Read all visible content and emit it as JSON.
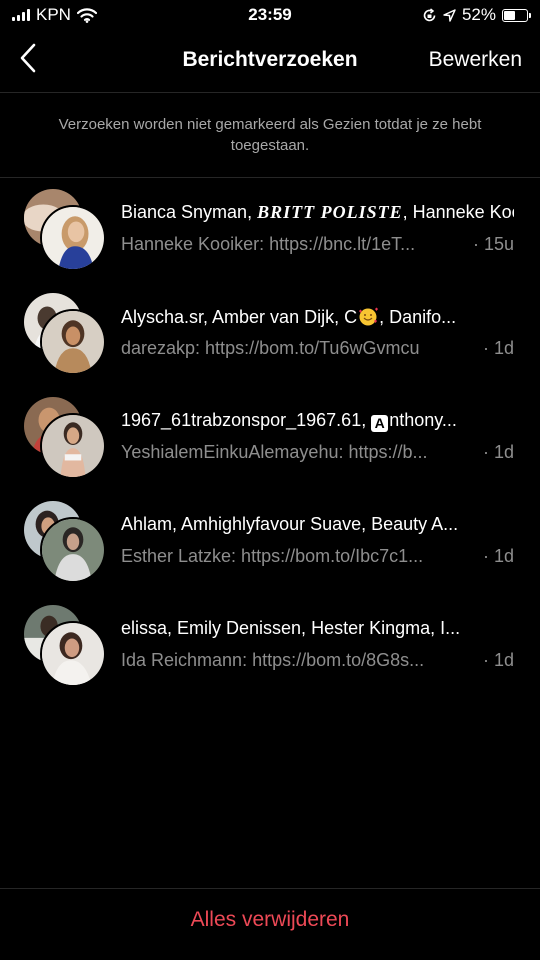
{
  "status_bar": {
    "carrier": "KPN",
    "time": "23:59",
    "battery_percent": "52%",
    "battery_level": 0.52
  },
  "header": {
    "title": "Berichtverzoeken",
    "edit_label": "Bewerken",
    "back_icon": "chevron-left-icon"
  },
  "notice": "Verzoeken worden niet gemarkeerd als Gezien totdat je ze hebt toegestaan.",
  "requests": [
    {
      "title_prefix": "Bianca Snyman, ",
      "title_special": "BRITT POLISTE",
      "title_suffix": ", Hanneke Kooiker",
      "preview": "Hanneke Kooiker: https://bnc.lt/1eT...",
      "time": "· 15u"
    },
    {
      "title_prefix": "Alyscha.sr, Amber van Dijk, C",
      "title_emoji": "smiling-face-with-hearts",
      "title_suffix": ", Danifo...",
      "preview": "darezakp: https://bom.to/Tu6wGvmcu",
      "time": "· 1d"
    },
    {
      "title_prefix": "1967_61trabzonspor_1967.61, ",
      "title_boxed_letter": "A",
      "title_suffix": "nthony...",
      "preview": "YeshialemEinkuAlemayehu: https://b...",
      "time": "· 1d"
    },
    {
      "title_prefix": "Ahlam, Amhighlyfavour Suave, Beauty A...",
      "preview": "Esther Latzke: https://bom.to/Ibc7c1...",
      "time": "· 1d"
    },
    {
      "title_prefix": "elissa, Emily Denissen, Hester Kingma, I...",
      "preview": "Ida Reichmann: https://bom.to/8G8s...",
      "time": "· 1d"
    }
  ],
  "footer": {
    "delete_all_label": "Alles verwijderen"
  },
  "colors": {
    "background": "#000000",
    "secondary_text": "#8e8e8e",
    "notice_text": "#a8a8a8",
    "divider": "#262626",
    "destructive": "#ed4956"
  }
}
